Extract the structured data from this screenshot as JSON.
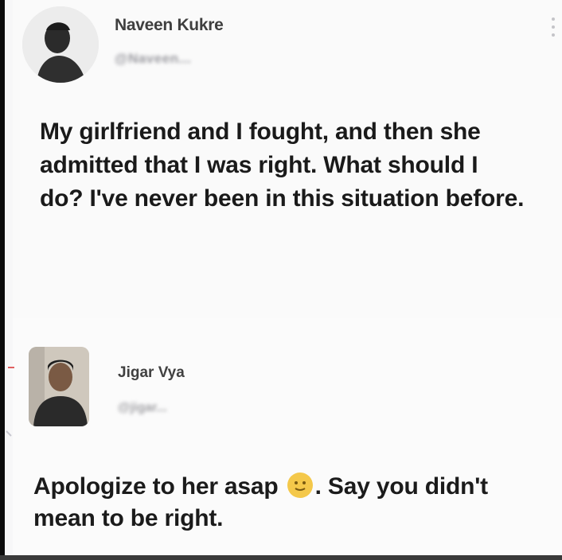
{
  "tweet": {
    "author_name": "Naveen Kukre",
    "author_handle": "@Naveen...",
    "text": "My girlfriend and I fought, and then she admitted that I was right. What should I do? I've never been in this situation before.",
    "avatar_icon": "person-silhouette-icon",
    "more_icon": "more-vertical-icon"
  },
  "reply": {
    "author_name": "Jigar Vya",
    "author_handle": "@jigar...",
    "text_before_emoji": "Apologize to her asap",
    "emoji": "smiling-emoji-icon",
    "text_after_emoji": ". Say you didn't mean to be right."
  },
  "colors": {
    "background": "#f7f7f8",
    "text": "#1a1a1a",
    "muted": "#9a9aa0",
    "emoji": "#f4c84a"
  }
}
